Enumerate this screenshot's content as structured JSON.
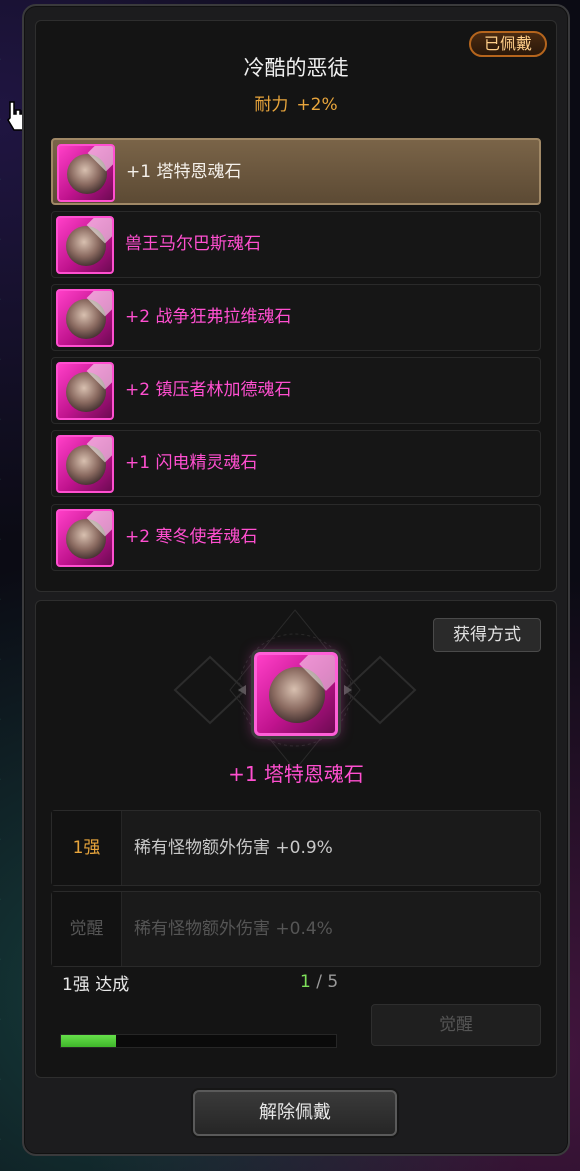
{
  "header": {
    "equipped_badge": "已佩戴",
    "title": "冷酷的恶徒",
    "bonus_stat": "耐力",
    "bonus_value": "+2%"
  },
  "stones": [
    {
      "label": "+1 塔特恩魂石",
      "selected": true
    },
    {
      "label": "兽王马尔巴斯魂石",
      "selected": false
    },
    {
      "label": "+2 战争狂弗拉维魂石",
      "selected": false
    },
    {
      "label": "+2 镇压者林加德魂石",
      "selected": false
    },
    {
      "label": "+1 闪电精灵魂石",
      "selected": false
    },
    {
      "label": "+2 寒冬使者魂石",
      "selected": false
    }
  ],
  "detail": {
    "obtain_button": "获得方式",
    "selected_name": "+1 塔特恩魂石",
    "effects": [
      {
        "tag": "1强",
        "text": "稀有怪物额外伤害 +0.9%",
        "active": true
      },
      {
        "tag": "觉醒",
        "text": "稀有怪物额外伤害 +0.4%",
        "active": false
      }
    ],
    "progress_label": "1强 达成",
    "progress_current": "1",
    "progress_sep": "/",
    "progress_total": "5",
    "progress_fraction": 0.2,
    "awaken_button": "觉醒"
  },
  "footer": {
    "unequip_button": "解除佩戴"
  },
  "colors": {
    "rarity_pink": "#ff4fd0",
    "bonus_orange": "#e8a53c",
    "progress_green": "#66e04a",
    "selected_row": "#7a6448"
  },
  "icons": [
    "stone-portrait-icon",
    "hand-cursor-icon",
    "emblem-frame-icon"
  ]
}
